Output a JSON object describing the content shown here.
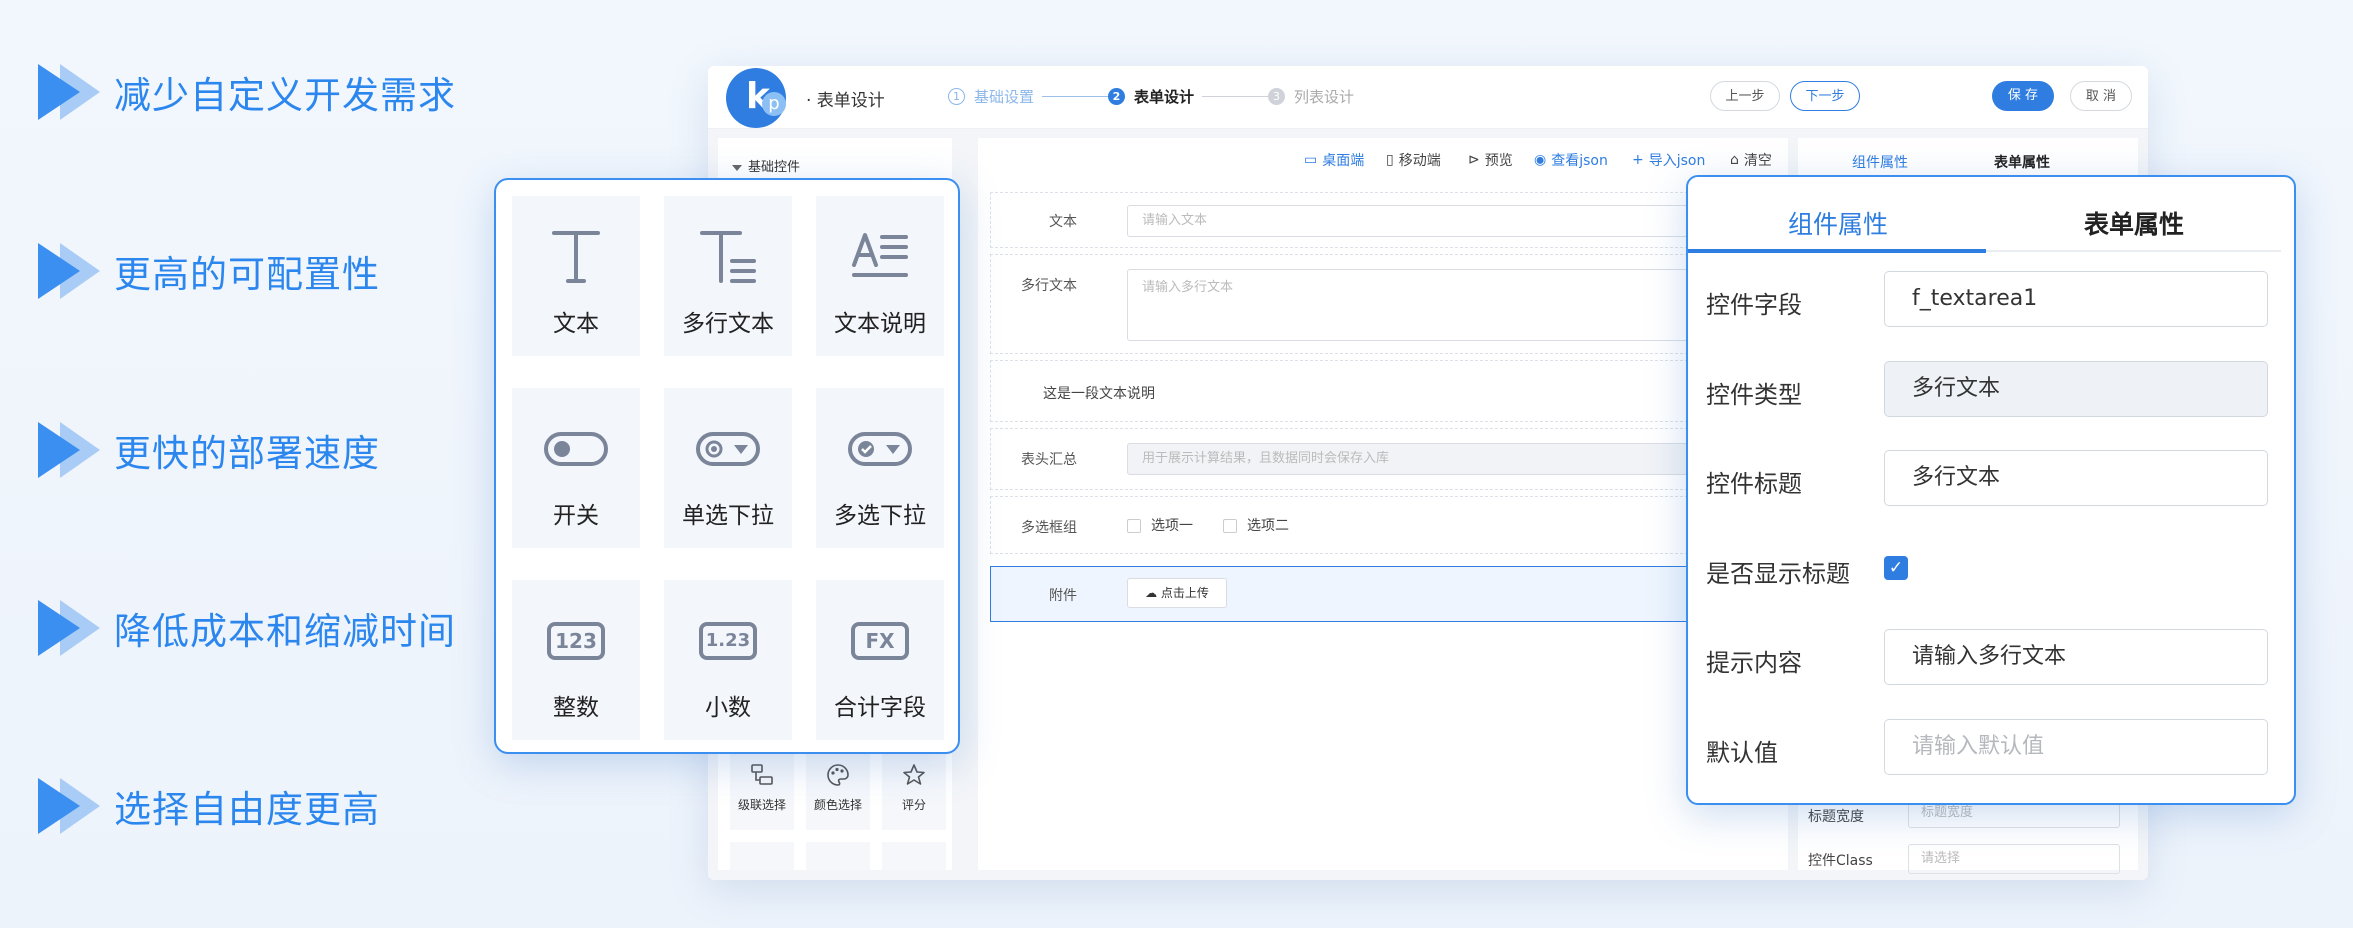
{
  "features": [
    "减少自定义开发需求",
    "更高的可配置性",
    "更快的部署速度",
    "降低成本和缩减时间",
    "选择自由度更高"
  ],
  "header": {
    "logo_k": "k",
    "logo_p": "p",
    "app_title": "· 表单设计",
    "steps": [
      {
        "num": "1",
        "label": "基础设置"
      },
      {
        "num": "2",
        "label": "表单设计"
      },
      {
        "num": "3",
        "label": "列表设计"
      }
    ],
    "prev_label": "上一步",
    "next_label": "下一步",
    "save_label": "保 存",
    "cancel_label": "取 消"
  },
  "left_panel": {
    "section_title": "基础控件",
    "bottom_items": [
      "级联选择",
      "颜色选择",
      "评分"
    ]
  },
  "toolbar": [
    "桌面端",
    "移动端",
    "预览",
    "查看json",
    "导入json",
    "清空"
  ],
  "form": {
    "text_label": "文本",
    "text_placeholder": "请输入文本",
    "textarea_label": "多行文本",
    "textarea_placeholder": "请输入多行文本",
    "desc_text": "这是一段文本说明",
    "summary_label": "表头汇总",
    "summary_placeholder": "用于展示计算结果，且数据同时会保存入库",
    "checkbox_label": "多选框组",
    "option1": "选项一",
    "option2": "选项二",
    "attach_label": "附件",
    "upload_label": "点击上传"
  },
  "right_panel": {
    "tab1": "组件属性",
    "tab2": "表单属性",
    "width_label": "标题宽度",
    "width_placeholder": "标题宽度",
    "class_label": "控件Class",
    "class_placeholder": "请选择"
  },
  "components": [
    "文本",
    "多行文本",
    "文本说明",
    "开关",
    "单选下拉",
    "多选下拉",
    "整数",
    "小数",
    "合计字段"
  ],
  "component_icon_text": {
    "int": "123",
    "decimal": "1.23",
    "sum": "FX"
  },
  "properties": {
    "tab_active": "组件属性",
    "tab_inactive": "表单属性",
    "field_label": "控件字段",
    "field_value": "f_textarea1",
    "type_label": "控件类型",
    "type_value": "多行文本",
    "title_label": "控件标题",
    "title_value": "多行文本",
    "show_title_label": "是否显示标题",
    "hint_label": "提示内容",
    "hint_value": "请输入多行文本",
    "default_label": "默认值",
    "default_placeholder": "请输入默认值"
  },
  "colors": {
    "accent": "#2f7de0",
    "feature_text": "#2b86ee",
    "arrow_light": "#a9ccf7"
  }
}
